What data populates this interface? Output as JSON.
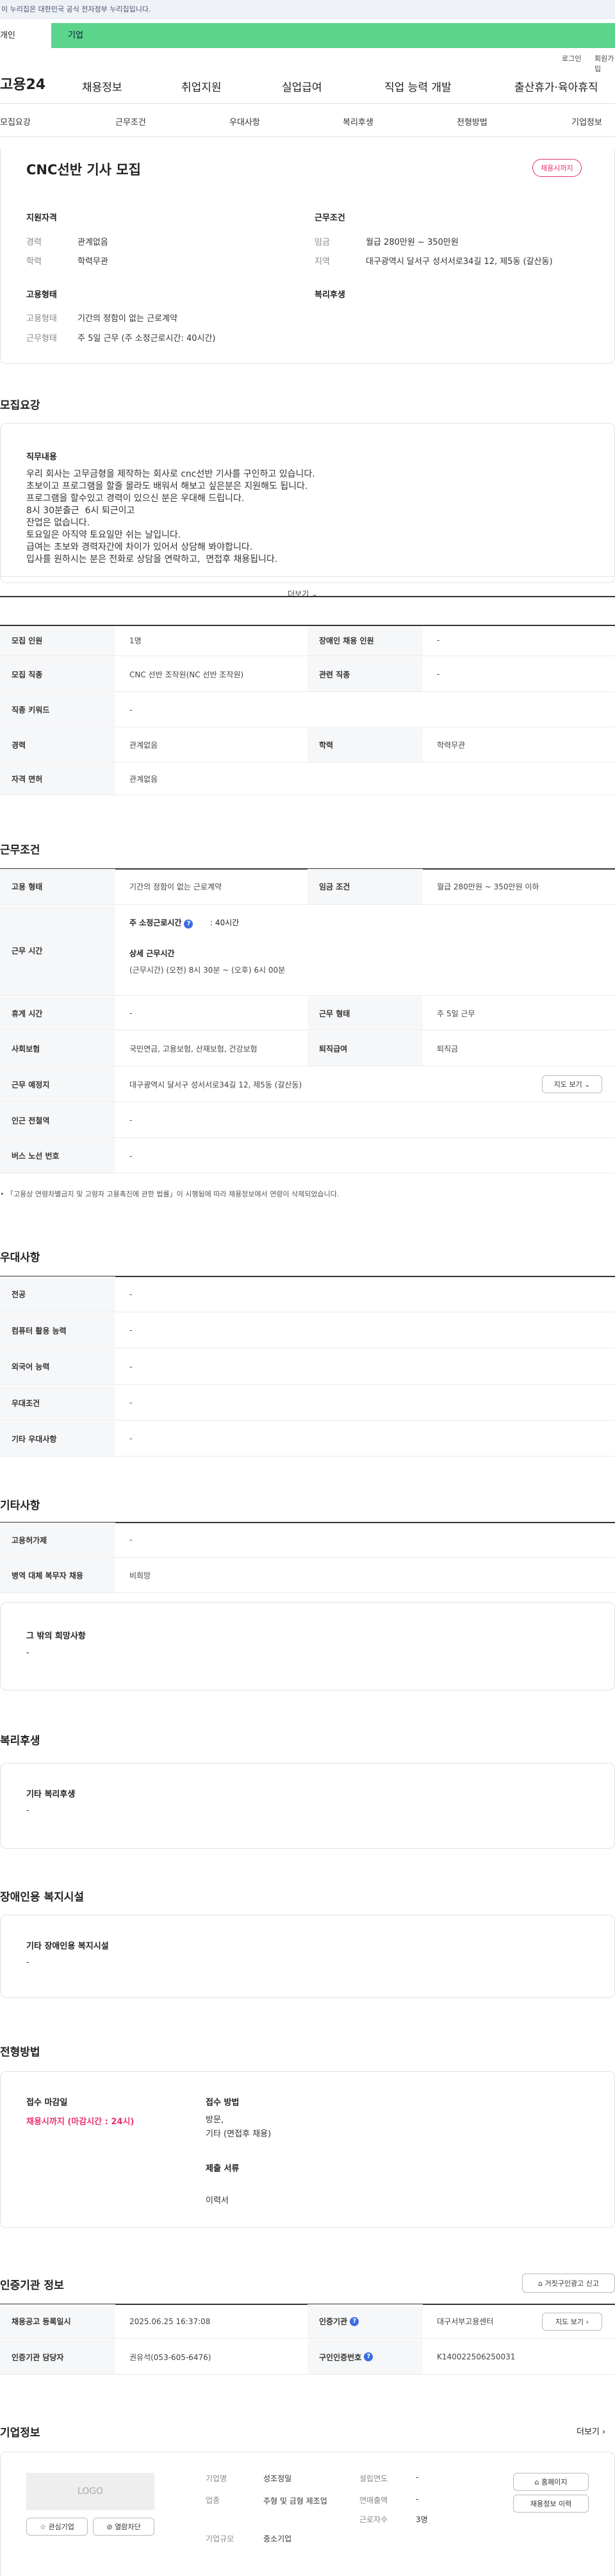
{
  "topbar": {
    "notice": "이 누리집은 대한민국 공식 전자정부 누리집입니다."
  },
  "site_tabs": {
    "person": "개인",
    "company": "기업"
  },
  "util": {
    "login": "로그인",
    "join": "회원가입"
  },
  "gnb": {
    "logo": "고용24",
    "menu": [
      "채용정보",
      "취업지원",
      "실업급여",
      "직업 능력 개발",
      "출산휴가·육아휴직"
    ]
  },
  "subtabs": [
    "모집요강",
    "근무조건",
    "우대사항",
    "복리후생",
    "전형방법",
    "기업정보"
  ],
  "summary": {
    "title": "CNC선반 기사 모집",
    "badge": "채용시까지",
    "qual_title": "지원자격",
    "cond_title": "근무조건",
    "career_k": "경력",
    "career_v": "관계없음",
    "edu_k": "학력",
    "edu_v": "학력무관",
    "wage_k": "임금",
    "wage_v": "월급 280만원 ~ 350만원",
    "area_k": "지역",
    "area_v": "대구광역시 달서구 성서서로34길 12, 제5동 (갈산동)",
    "emp_title": "고용형태",
    "welfare_title": "복리후생",
    "emptype_k": "고용형태",
    "emptype_v": "기간의 정함이 없는 근로계약",
    "worktype_k": "근무형태",
    "worktype_v": "주 5일 근무 (주 소정근로시간: 40시간)"
  },
  "recruit": {
    "section_title": "모집요강",
    "job_title": "직무내용",
    "job_text": "우리 회사는 고무금형을 제작하는 회사로 cnc선반 기사를 구인하고 있습니다.\n초보이고 프로그램을 할줄 몰라도 배워서 해보고 싶은분은 지원해도 됩니다.\n프로그램을 할수있고 경력이 있으신 분은 우대해 드립니다.\n8시 30분출근  6시 퇴근이고\n잔업은 없습니다.\n토요일은 아직약 토요일만 쉬는 날입니다.\n급여는 초보와 경력자간에 차이가 있어서 상담해 봐야합니다.\n입사를 원하시는 분은 전화로 상담을 연락하고,  면접후 채용됩니다.",
    "more": "더보기",
    "table": {
      "headcount_k": "모집 인원",
      "headcount_v": "1명",
      "disabled_k": "장애인 채용 인원",
      "disabled_v": "-",
      "job_k": "모집 직종",
      "job_v": "CNC 선반 조작원(NC 선반 조작원)",
      "related_k": "관련 직종",
      "related_v": "-",
      "keyword_k": "직종 키워드",
      "keyword_v": "-",
      "career_k": "경력",
      "career_v": "관계없음",
      "edu_k": "학력",
      "edu_v": "학력무관",
      "license_k": "자격 면허",
      "license_v": "관계없음"
    }
  },
  "conditions": {
    "section_title": "근무조건",
    "emptype_k": "고용 형태",
    "emptype_v": "기간의 정함이 없는 근로계약",
    "wage_k": "임금 조건",
    "wage_v": "월급 280만원 ~ 350만원 이하",
    "hours_k": "근무 시간",
    "weekly_label": "주 소정근로시간",
    "weekly_v": ": 40시간",
    "detail_label": "상세 근무시간",
    "detail_v": "(근무시간) (오전) 8시 30분 ~ (오후) 6시 00분",
    "holiday_k": "휴게 시간",
    "holiday_v": "-",
    "worktype_k": "근무 형태",
    "worktype_v": "주 5일 근무",
    "insurance_k": "사회보험",
    "insurance_v": "국민연금, 고용보험, 산재보험, 건강보험",
    "retire_k": "퇴직급여",
    "retire_v": "퇴직금",
    "place_k": "근무 예정지",
    "place_v": "대구광역시 달서구 성서서로34길 12, 제5동 (갈산동)",
    "map_btn": "지도 보기",
    "subway_k": "인근 전철역",
    "subway_v": "-",
    "bus_k": "버스 노선 번호",
    "bus_v": "-",
    "footnote": "「고용상 연령차별금지 및 고령자 고용촉진에 관한 법률」이 시행됨에 따라 채용정보에서 연령이 삭제되었습니다."
  },
  "preference": {
    "section_title": "우대사항",
    "rows": [
      {
        "k": "전공",
        "v": "-"
      },
      {
        "k": "컴퓨터 활용 능력",
        "v": "-"
      },
      {
        "k": "외국어 능력",
        "v": "-"
      },
      {
        "k": "우대조건",
        "v": "-"
      },
      {
        "k": "기타 우대사항",
        "v": "-"
      }
    ]
  },
  "etc": {
    "section_title": "기타사항",
    "rows": [
      {
        "k": "고용허가제",
        "v": "-"
      },
      {
        "k": "병역 대체 복무자 채용",
        "v": "비희망"
      }
    ],
    "wish_title": "그 밖의 희망사항",
    "wish_v": "-"
  },
  "welfare": {
    "section_title": "복리후생",
    "box_title": "기타 복리후생",
    "box_v": "-"
  },
  "disabled": {
    "section_title": "장애인용 복지시설",
    "box_title": "기타 장애인용 복지시설",
    "box_v": "-"
  },
  "selection": {
    "section_title": "전형방법",
    "deadline_title": "접수 마감일",
    "deadline_v": "채용시까지 (마감시간 : 24시)",
    "method_title": "접수 방법",
    "method_v": "방문,\n기타 (면접후 채용)",
    "docs_title": "제출 서류",
    "docs_v": "이력서"
  },
  "agency": {
    "section_title": "인증기관 정보",
    "report_btn": "거짓구인광고 신고",
    "reg_k": "채용공고 등록일시",
    "reg_v": "2025.06.25 16:37:08",
    "org_k": "인증기관",
    "org_v": "대구서부고용센터",
    "map_btn": "지도 보기",
    "manager_k": "인증기관 담당자",
    "manager_v": "권유석(053-605-6476)",
    "id_k": "구인인증번호",
    "id_v": "K140022506250031"
  },
  "company": {
    "section_title": "기업정보",
    "more": "더보기",
    "logo": "LOGO",
    "fav_btn": "관심기업",
    "block_btn": "열람차단",
    "name_k": "기업명",
    "name_v": "성조정밀",
    "industry_k": "업종",
    "industry_v": "주형 및 금형 제조업",
    "scale_k": "기업규모",
    "scale_v": "중소기업",
    "year_k": "설립연도",
    "year_v": "-",
    "sales_k": "연매출액",
    "sales_v": "-",
    "emp_k": "근로자수",
    "emp_v": "3명",
    "home_btn": "홈페이지",
    "jobs_btn": "채용정보 이력"
  },
  "colors": {
    "accent": "#5bd48c",
    "badge": "#e8336d",
    "link_red": "#e8336d",
    "help": "#3b6de0"
  }
}
